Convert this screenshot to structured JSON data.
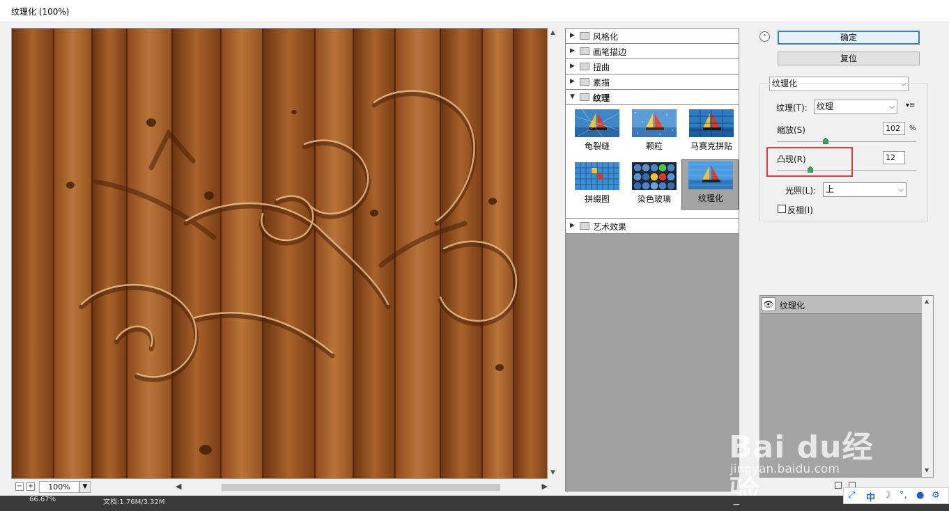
{
  "window": {
    "title": "纹理化 (100%)"
  },
  "preview": {
    "zoom_value": "100%"
  },
  "gallery": {
    "folders": [
      {
        "label": "风格化",
        "open": false
      },
      {
        "label": "画笔描边",
        "open": false
      },
      {
        "label": "扭曲",
        "open": false
      },
      {
        "label": "素描",
        "open": false
      },
      {
        "label": "纹理",
        "open": true
      },
      {
        "label": "艺术效果",
        "open": false
      }
    ],
    "texture_filters": [
      "龟裂缝",
      "颗粒",
      "马赛克拼贴",
      "拼缀图",
      "染色玻璃",
      "纹理化"
    ],
    "selected_filter": "纹理化"
  },
  "settings": {
    "ok_label": "确定",
    "reset_label": "复位",
    "filter_select": "纹理化",
    "texture_label": "纹理(T):",
    "texture_value": "纹理",
    "scaling_label": "缩放(S)",
    "scaling_value": "102",
    "scaling_unit": "%",
    "scaling_level": 0.35,
    "relief_label": "凸现(R)",
    "relief_value": "12",
    "relief_level": 0.24,
    "light_label": "光照(L):",
    "light_value": "上",
    "invert_label": "反相(I)",
    "invert_checked": false
  },
  "layers": {
    "items": [
      {
        "name": "纹理化"
      }
    ]
  },
  "statusbar": {
    "zoom": "66.67%",
    "doc": "文档:1.76M/3.32M"
  },
  "ime": {
    "mode": "中"
  },
  "watermark": {
    "brand": "Bai du经验",
    "url": "jingyan.baidu.com"
  },
  "colors": {
    "wood": "#8a4a1f",
    "highlight_box": "#e53935",
    "primary_border": "#3c7fb1",
    "gallery_bg": "#a0a0a0"
  }
}
